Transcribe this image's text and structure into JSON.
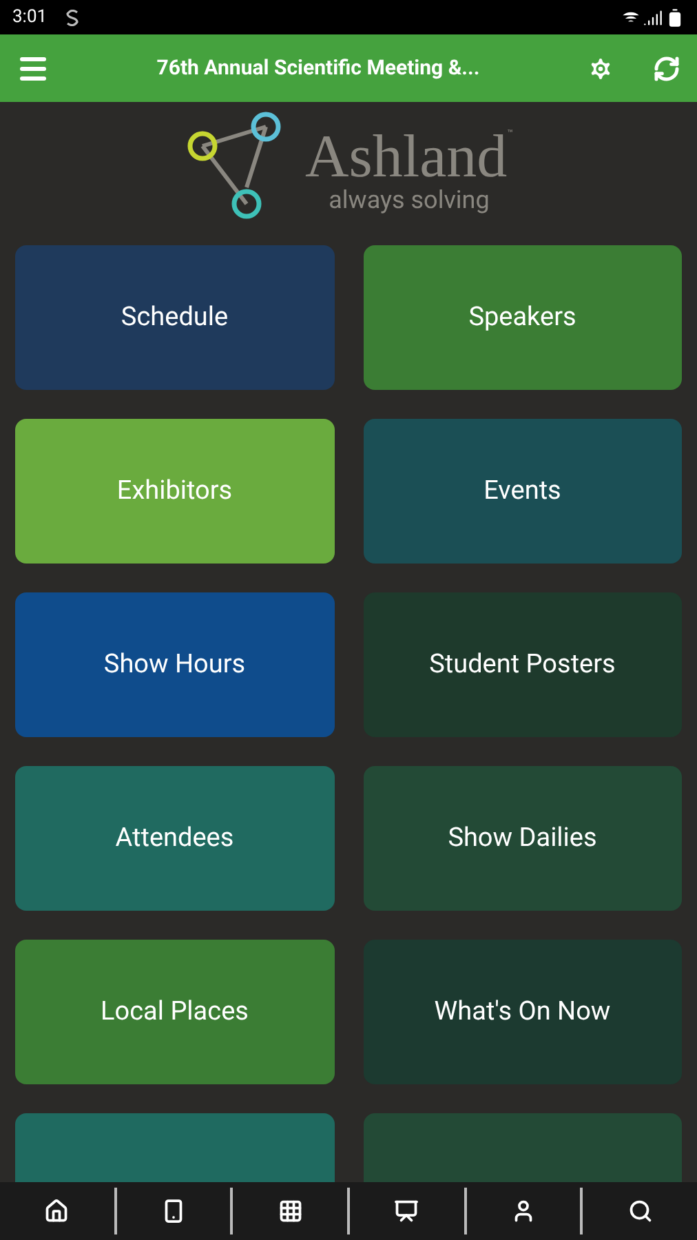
{
  "status_bar": {
    "time": "3:01"
  },
  "app_bar": {
    "title": "76th Annual Scientific Meeting &..."
  },
  "logo": {
    "name": "Ashland",
    "mark": "™",
    "tagline": "always solving"
  },
  "tiles": [
    {
      "label": "Schedule",
      "color": "#1f3a5c"
    },
    {
      "label": "Speakers",
      "color": "#3b7d34"
    },
    {
      "label": "Exhibitors",
      "color": "#6aab3e"
    },
    {
      "label": "Events",
      "color": "#1b4f55"
    },
    {
      "label": "Show Hours",
      "color": "#0f4c8c"
    },
    {
      "label": "Student Posters",
      "color": "#1e3a2c"
    },
    {
      "label": "Attendees",
      "color": "#206a60"
    },
    {
      "label": "Show Dailies",
      "color": "#234a36"
    },
    {
      "label": "Local Places",
      "color": "#3b7d34"
    },
    {
      "label": "What's On Now",
      "color": "#1c3a30"
    },
    {
      "color": "#1f6a60"
    },
    {
      "color": "#234a36"
    }
  ],
  "bottom_nav": [
    {
      "kind": "home"
    },
    {
      "kind": "phone"
    },
    {
      "kind": "grid"
    },
    {
      "kind": "easel"
    },
    {
      "kind": "person"
    },
    {
      "kind": "search"
    }
  ]
}
